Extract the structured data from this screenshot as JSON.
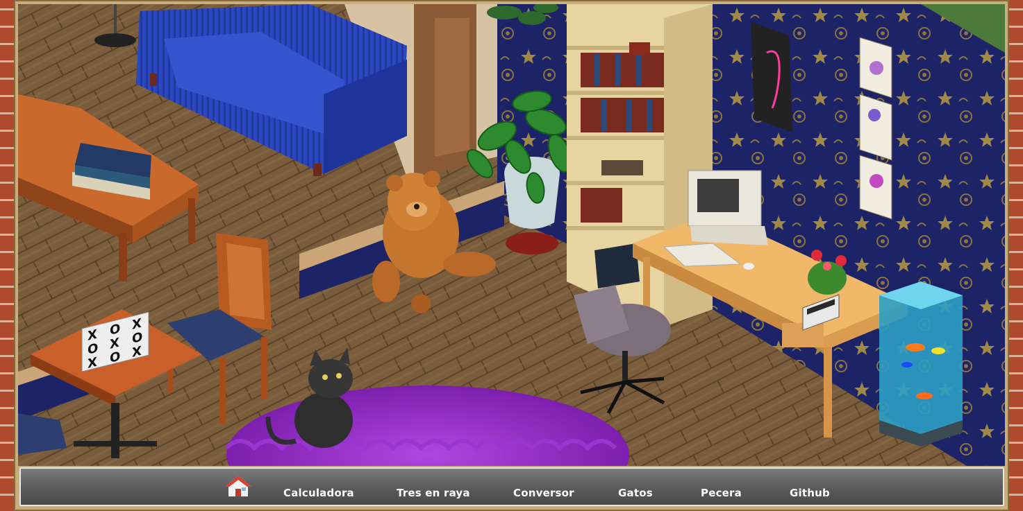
{
  "navbar": {
    "home_icon": "house-icon",
    "items": [
      {
        "label": "Calculadora"
      },
      {
        "label": "Tres en raya"
      },
      {
        "label": "Conversor"
      },
      {
        "label": "Gatos"
      },
      {
        "label": "Pecera"
      },
      {
        "label": "Github"
      }
    ]
  },
  "scene": {
    "objects": [
      "sofa",
      "coffee-table",
      "books",
      "dining-chair",
      "tic-tac-toe-table",
      "teddy-bear",
      "potted-plant",
      "bookshelf",
      "computer",
      "desk",
      "office-chair",
      "cat",
      "purple-rug",
      "flamingo-poster",
      "flower-prints",
      "flower-pot",
      "calculator",
      "fish-tank"
    ],
    "tictactoe_board": [
      "X",
      "O",
      "X",
      "O",
      "X",
      "O",
      "X",
      "O",
      "X"
    ],
    "colors": {
      "wall": "#1c2366",
      "floor": "#7a5d3c",
      "sofa": "#2a44b8",
      "rug": "#8e2bc4",
      "nav": "#5f5f5f"
    }
  }
}
